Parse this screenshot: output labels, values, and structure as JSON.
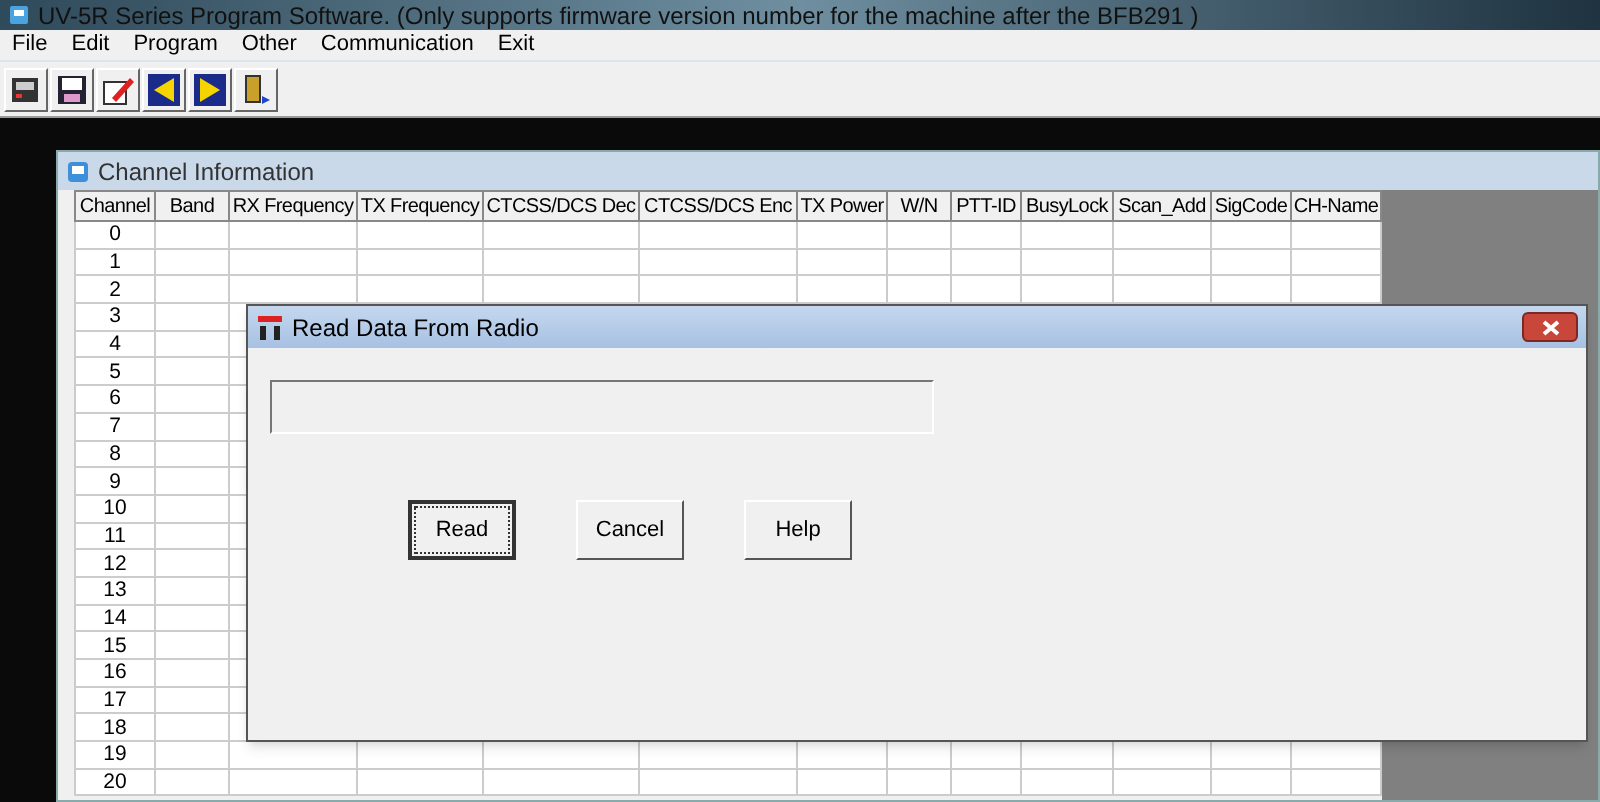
{
  "window": {
    "title": "UV-5R Series Program Software. (Only supports firmware version number for the machine after the BFB291 )"
  },
  "menu": [
    "File",
    "Edit",
    "Program",
    "Other",
    "Communication",
    "Exit"
  ],
  "child_window": {
    "title": "Channel Information"
  },
  "table": {
    "columns": [
      "Channel",
      "Band",
      "RX Frequency",
      "TX Frequency",
      "CTCSS/DCS Dec",
      "CTCSS/DCS Enc",
      "TX Power",
      "W/N",
      "PTT-ID",
      "BusyLock",
      "Scan_Add",
      "SigCode",
      "CH-Name"
    ],
    "rows": [
      "0",
      "1",
      "2",
      "3",
      "4",
      "5",
      "6",
      "7",
      "8",
      "9",
      "10",
      "11",
      "12",
      "13",
      "14",
      "15",
      "16",
      "17",
      "18",
      "19",
      "20"
    ]
  },
  "dialog": {
    "title": "Read Data From Radio",
    "progress": {
      "level": 0
    },
    "buttons": [
      {
        "label": "Read",
        "focused": true
      },
      {
        "label": "Cancel",
        "focused": false
      },
      {
        "label": "Help",
        "focused": false
      }
    ]
  }
}
